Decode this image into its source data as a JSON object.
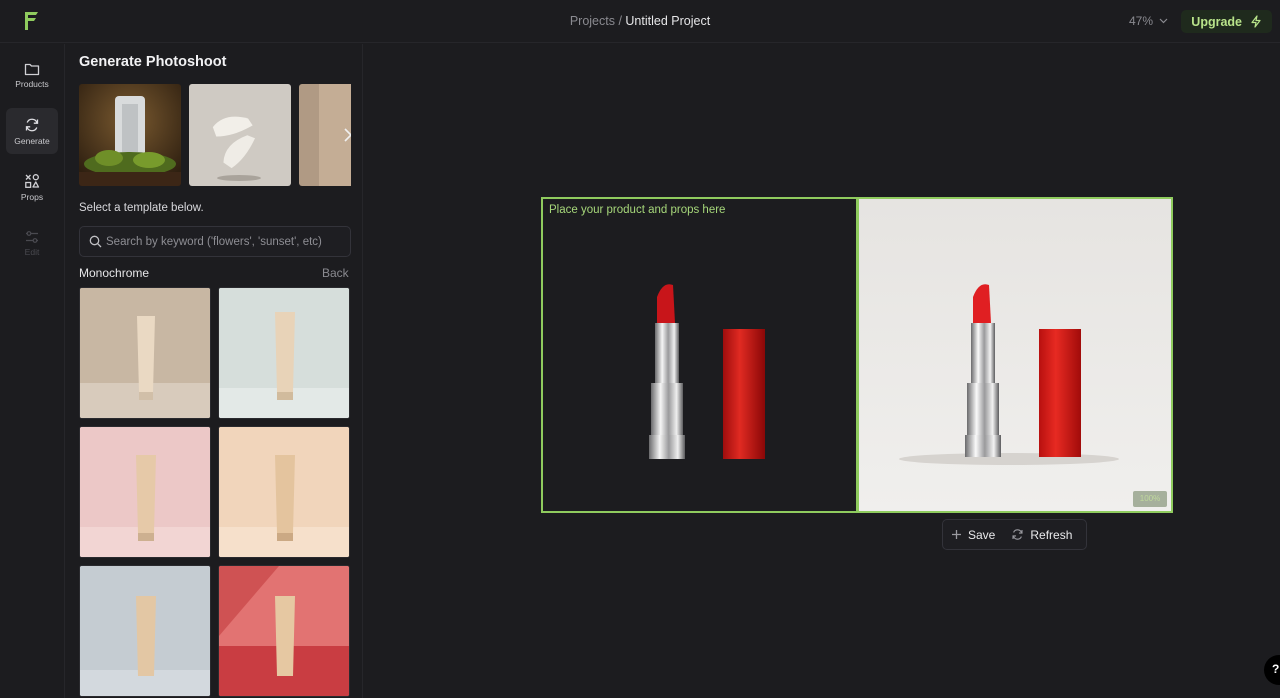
{
  "topbar": {
    "breadcrumb_parent": "Projects",
    "breadcrumb_sep": " / ",
    "breadcrumb_current": "Untitled Project",
    "zoom": "47%",
    "upgrade_label": "Upgrade",
    "accent": "#b8e38a"
  },
  "rail": {
    "items": [
      {
        "label": "Products",
        "icon": "folder-icon"
      },
      {
        "label": "Generate",
        "icon": "refresh-icon",
        "active": true
      },
      {
        "label": "Props",
        "icon": "shapes-icon"
      },
      {
        "label": "Edit",
        "icon": "sliders-icon",
        "disabled": true
      }
    ]
  },
  "panel": {
    "title": "Generate Photoshoot",
    "hint": "Select a template below.",
    "search_placeholder": "Search by keyword ('flowers', 'sunset', etc)",
    "category": "Monochrome",
    "back_label": "Back",
    "carousel": [
      {
        "icon": "air-purifier-on-moss-thumbnail"
      },
      {
        "icon": "floating-sneakers-thumbnail"
      },
      {
        "icon": "beige-thumbnail"
      }
    ],
    "templates": [
      {
        "icon": "tube-template",
        "bg": "#c9b8a4"
      },
      {
        "icon": "tube-template",
        "bg": "#d8dfdc"
      },
      {
        "icon": "tube-template",
        "bg": "#ecc7c6"
      },
      {
        "icon": "tube-template",
        "bg": "#f2d6bd"
      },
      {
        "icon": "tube-template",
        "bg": "#c6ccd2"
      },
      {
        "icon": "tube-template",
        "bg": "#d9585a"
      }
    ]
  },
  "canvas": {
    "placeholder_text": "Place your product and props here",
    "badge": "100%",
    "frame_color": "#8fcb5e"
  },
  "actions": {
    "save_label": "Save",
    "refresh_label": "Refresh"
  },
  "help": {
    "label": "?"
  }
}
